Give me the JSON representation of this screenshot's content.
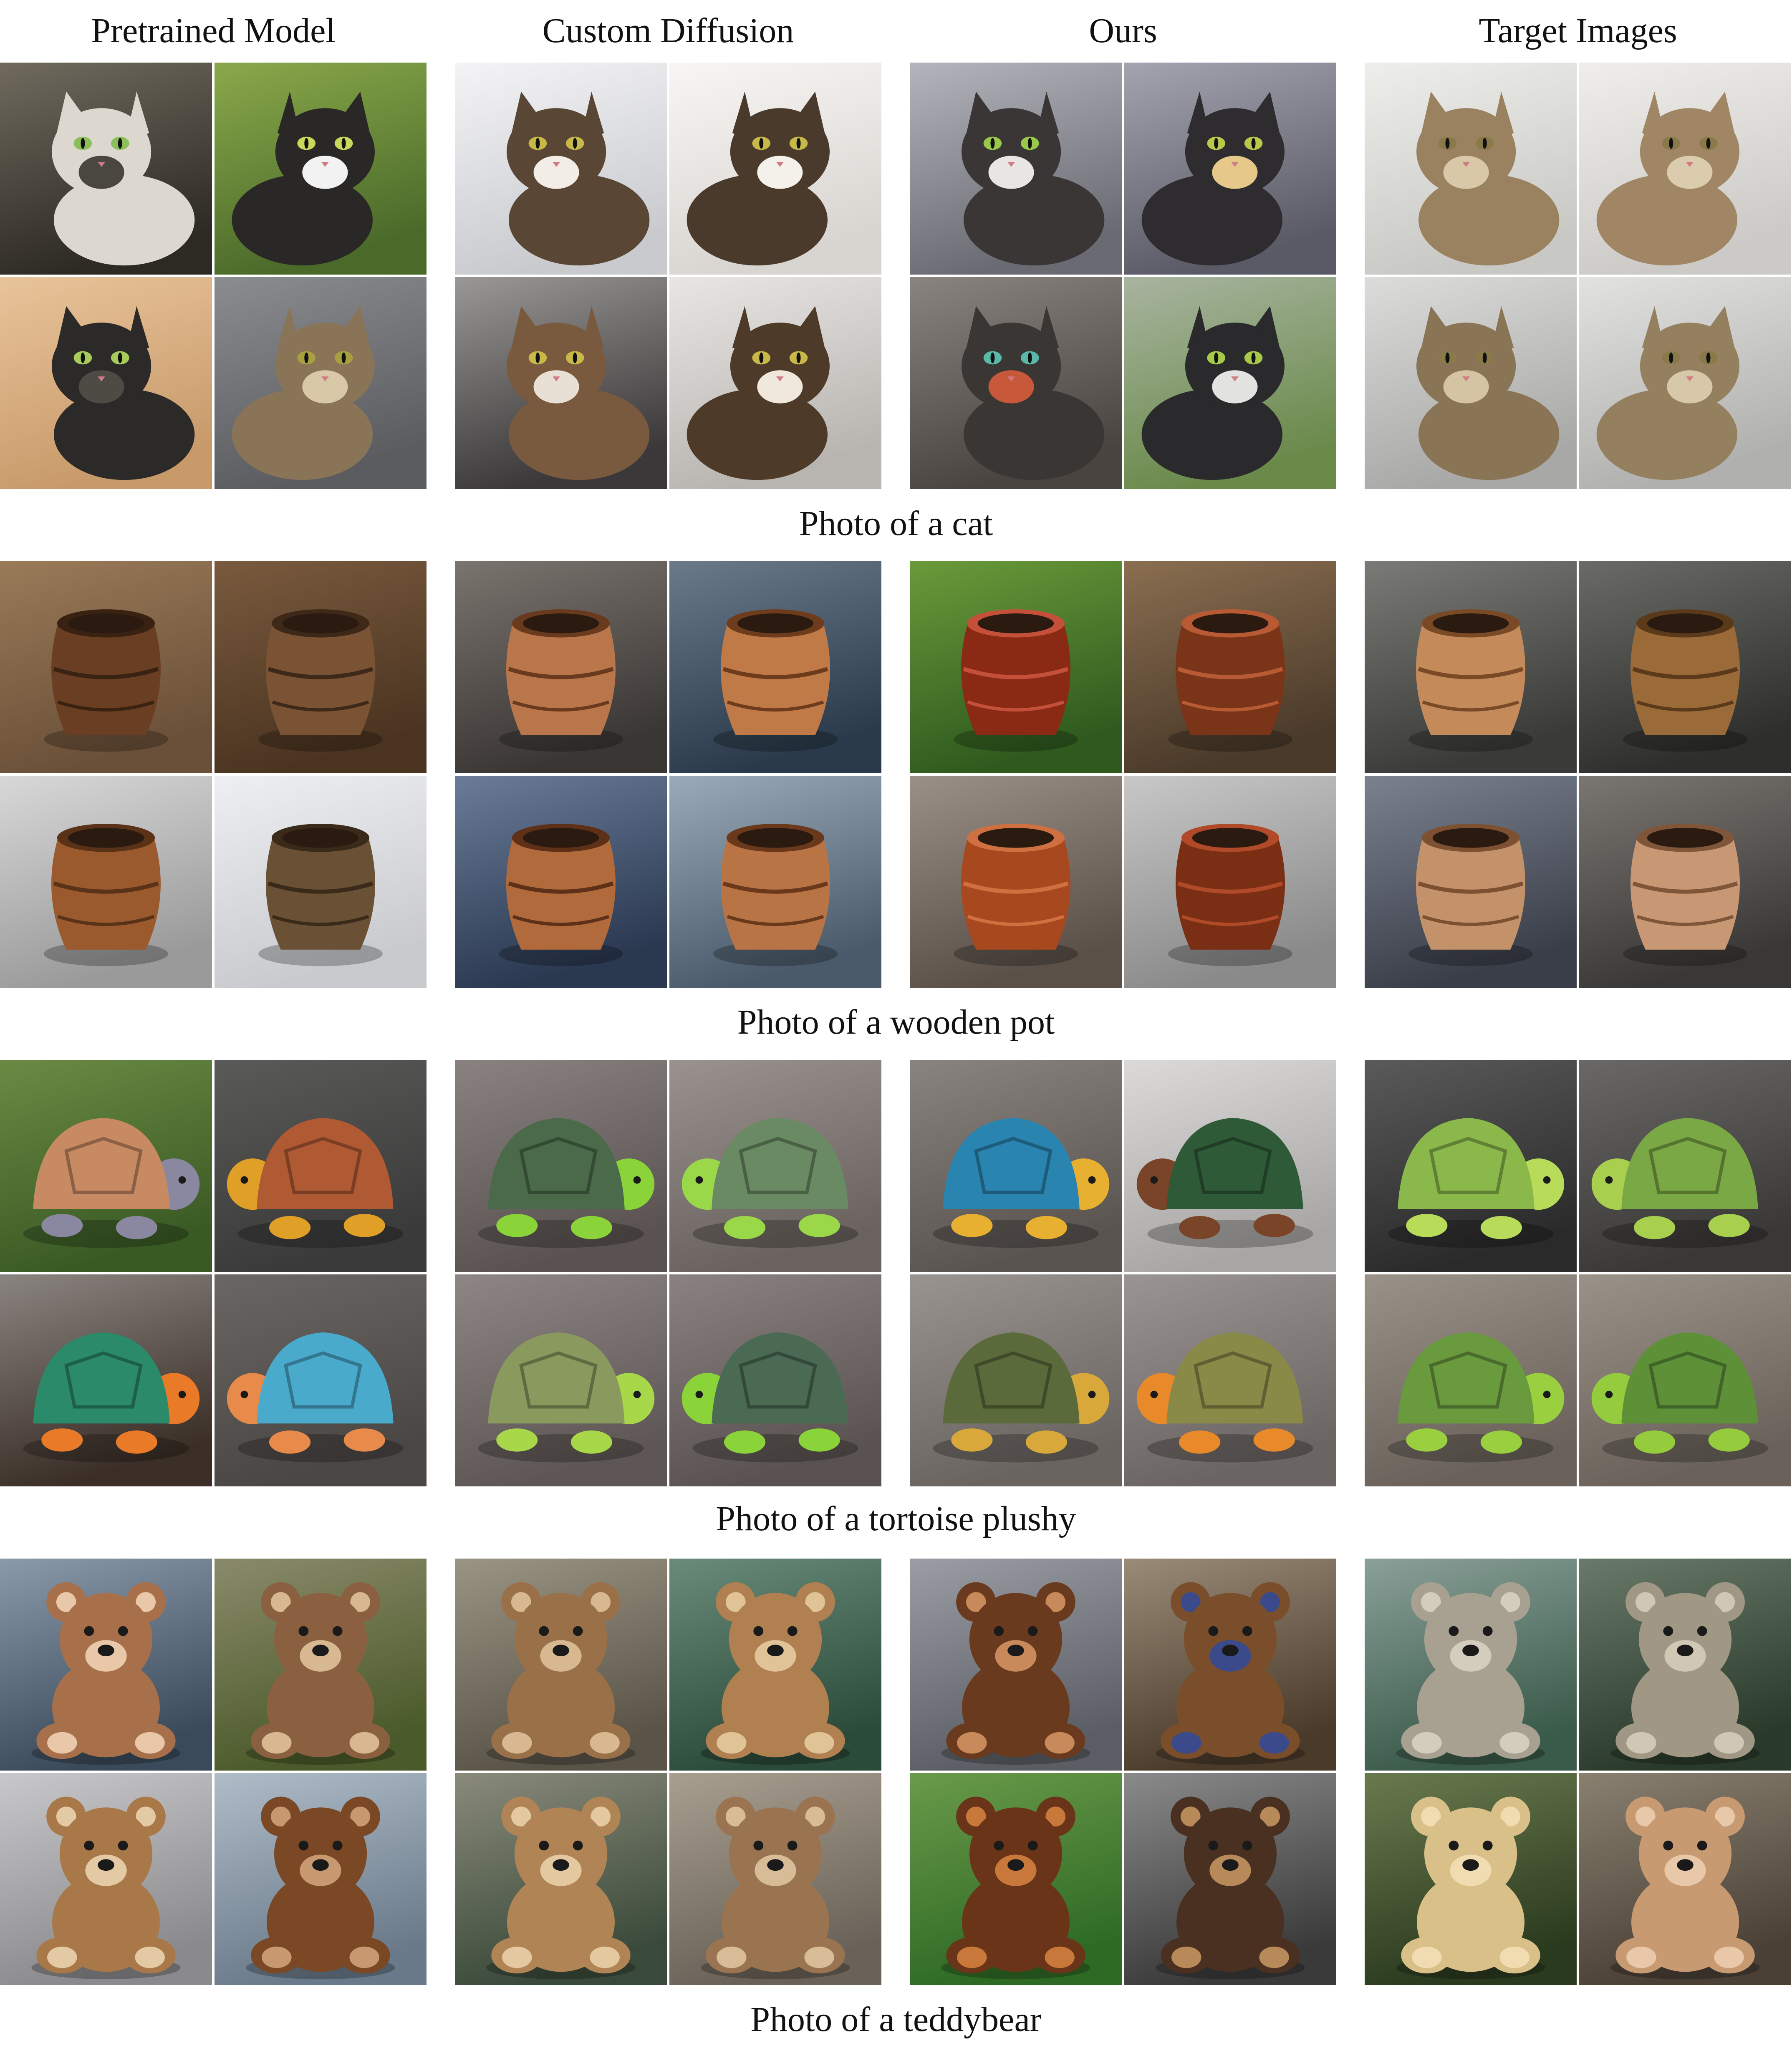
{
  "columns": [
    "Pretrained Model",
    "Custom Diffusion",
    "Ours",
    "Target Images"
  ],
  "rows": [
    {
      "caption": "Photo of a cat",
      "subject": "cat",
      "groups": [
        {
          "tiles": [
            {
              "bg": [
                "#2d2a24",
                "#706a5e"
              ],
              "obj": "#dcd8cf",
              "accent": "#4a4640",
              "eye": "#8bbf5a"
            },
            {
              "bg": [
                "#4a6a2a",
                "#8aa84a"
              ],
              "obj": "#2a2826",
              "accent": "#f2f2f2",
              "eye": "#c8d85a"
            },
            {
              "bg": [
                "#c89a6a",
                "#e8c49a"
              ],
              "obj": "#2c2a28",
              "accent": "#4e4a44",
              "eye": "#a8cc5a"
            },
            {
              "bg": [
                "#5a5c60",
                "#8a8c90"
              ],
              "obj": "#8a7458",
              "accent": "#d8c8a8",
              "eye": "#a8a040"
            }
          ]
        },
        {
          "tiles": [
            {
              "bg": [
                "#c8cace",
                "#f4f4f6"
              ],
              "obj": "#5a4634",
              "accent": "#f2ede6",
              "eye": "#c8b848"
            },
            {
              "bg": [
                "#d8d4d0",
                "#f8f6f4"
              ],
              "obj": "#4a3a2c",
              "accent": "#f4f0ea",
              "eye": "#c8b848"
            },
            {
              "bg": [
                "#3a3838",
                "#9a9896"
              ],
              "obj": "#7a5a3e",
              "accent": "#e8e0d4",
              "eye": "#c8b848"
            },
            {
              "bg": [
                "#b8b4b0",
                "#e8e6e4"
              ],
              "obj": "#4e3a28",
              "accent": "#f0e8dc",
              "eye": "#c8b848"
            }
          ]
        },
        {
          "tiles": [
            {
              "bg": [
                "#6a6a72",
                "#b4b4bc"
              ],
              "obj": "#3a3636",
              "accent": "#e8e6e2",
              "eye": "#9ac84a"
            },
            {
              "bg": [
                "#5a5a66",
                "#a4a4b0"
              ],
              "obj": "#2e2c2e",
              "accent": "#e6c88a",
              "eye": "#b8c848"
            },
            {
              "bg": [
                "#4a4440",
                "#8a8480"
              ],
              "obj": "#3a3634",
              "accent": "#c8583a",
              "eye": "#5ab8a8"
            },
            {
              "bg": [
                "#6a8a4a",
                "#a8b4a0"
              ],
              "obj": "#2a2a2c",
              "accent": "#e2e2e0",
              "eye": "#a8c848"
            }
          ]
        },
        {
          "tiles": [
            {
              "bg": [
                "#c8c8c4",
                "#eeeeea"
              ],
              "obj": "#9a8260",
              "accent": "#d8c8a8",
              "eye": "#8a7a4a"
            },
            {
              "bg": [
                "#cccac6",
                "#f0eeea"
              ],
              "obj": "#a08664",
              "accent": "#dcccae",
              "eye": "#8a7a4a"
            },
            {
              "bg": [
                "#a8a8a6",
                "#dcdcda"
              ],
              "obj": "#8a7456",
              "accent": "#d4c4a4",
              "eye": "#8a7a4a"
            },
            {
              "bg": [
                "#b0b0ae",
                "#e2e2e0"
              ],
              "obj": "#94805e",
              "accent": "#d8c8aa",
              "eye": "#8a7a4a"
            }
          ]
        }
      ]
    },
    {
      "caption": "Photo of a wooden pot",
      "subject": "pot",
      "groups": [
        {
          "tiles": [
            {
              "bg": [
                "#6a5038",
                "#9a7a58"
              ],
              "obj": "#6a3e22",
              "accent": "#3a2212",
              "eye": "#000000"
            },
            {
              "bg": [
                "#4a3420",
                "#7a5a3e"
              ],
              "obj": "#7a5234",
              "accent": "#3e2818",
              "eye": "#000000"
            },
            {
              "bg": [
                "#9a9a9a",
                "#d8d8d8"
              ],
              "obj": "#9a5a2e",
              "accent": "#5a3218",
              "eye": "#000000"
            },
            {
              "bg": [
                "#c8cace",
                "#eeeff2"
              ],
              "obj": "#6a5034",
              "accent": "#3a2a1a",
              "eye": "#000000"
            }
          ]
        },
        {
          "tiles": [
            {
              "bg": [
                "#3a3634",
                "#7a746e"
              ],
              "obj": "#b8764a",
              "accent": "#6a3a1e",
              "eye": "#000000"
            },
            {
              "bg": [
                "#2a3a4a",
                "#6a7a8a"
              ],
              "obj": "#c07a48",
              "accent": "#6e3c1c",
              "eye": "#000000"
            },
            {
              "bg": [
                "#2a3850",
                "#6a7c98"
              ],
              "obj": "#b06a3c",
              "accent": "#5e3018",
              "eye": "#000000"
            },
            {
              "bg": [
                "#4a5a6a",
                "#9aaab8"
              ],
              "obj": "#b87444",
              "accent": "#6a381a",
              "eye": "#000000"
            }
          ]
        },
        {
          "tiles": [
            {
              "bg": [
                "#2e5a1e",
                "#6a9a3a"
              ],
              "obj": "#8a2a14",
              "accent": "#c4503a",
              "eye": "#000000"
            },
            {
              "bg": [
                "#4a3a2a",
                "#8a6e50"
              ],
              "obj": "#7a3418",
              "accent": "#b85a34",
              "eye": "#000000"
            },
            {
              "bg": [
                "#5a5048",
                "#9a9088"
              ],
              "obj": "#a8481e",
              "accent": "#d07040",
              "eye": "#000000"
            },
            {
              "bg": [
                "#8a8a8a",
                "#c8c8c8"
              ],
              "obj": "#7a2e14",
              "accent": "#b04a28",
              "eye": "#000000"
            }
          ]
        },
        {
          "tiles": [
            {
              "bg": [
                "#3a3a38",
                "#7a7a76"
              ],
              "obj": "#c48a5a",
              "accent": "#7a4a26",
              "eye": "#000000"
            },
            {
              "bg": [
                "#2e2e2c",
                "#6a6a66"
              ],
              "obj": "#9a6a38",
              "accent": "#5a3a1a",
              "eye": "#000000"
            },
            {
              "bg": [
                "#3a3e48",
                "#7a8290"
              ],
              "obj": "#c4926a",
              "accent": "#7e5032",
              "eye": "#000000"
            },
            {
              "bg": [
                "#3a3836",
                "#7a7672"
              ],
              "obj": "#c89874",
              "accent": "#80563a",
              "eye": "#000000"
            }
          ]
        }
      ]
    },
    {
      "caption": "Photo of a tortoise plushy",
      "subject": "tortoise",
      "groups": [
        {
          "tiles": [
            {
              "bg": [
                "#3a5a24",
                "#6a8a44"
              ],
              "obj": "#c88a62",
              "accent": "#8a88a0",
              "eye": "#1a1a1a"
            },
            {
              "bg": [
                "#3a3a3a",
                "#5a5a58"
              ],
              "obj": "#b05a34",
              "accent": "#e0a028",
              "eye": "#1a1a1a"
            },
            {
              "bg": [
                "#3a2e26",
                "#8a8480"
              ],
              "obj": "#2a8a6a",
              "accent": "#e87a28",
              "eye": "#1a1a1a"
            },
            {
              "bg": [
                "#4a4644",
                "#6a6664"
              ],
              "obj": "#4aaacc",
              "accent": "#e88a4a",
              "eye": "#1a1a1a"
            }
          ]
        },
        {
          "tiles": [
            {
              "bg": [
                "#5a5250",
                "#8a8280"
              ],
              "obj": "#4a6a4a",
              "accent": "#8ad43a",
              "eye": "#1a1a1a"
            },
            {
              "bg": [
                "#6a625e",
                "#9a928e"
              ],
              "obj": "#6a8a64",
              "accent": "#9ad84a",
              "eye": "#1a1a1a"
            },
            {
              "bg": [
                "#5e5654",
                "#8e8684"
              ],
              "obj": "#8a9a5e",
              "accent": "#a8d84a",
              "eye": "#1a1a1a"
            },
            {
              "bg": [
                "#5a5250",
                "#8a8280"
              ],
              "obj": "#4a6a54",
              "accent": "#8ad43a",
              "eye": "#1a1a1a"
            }
          ]
        },
        {
          "tiles": [
            {
              "bg": [
                "#5a5450",
                "#8a8480"
              ],
              "obj": "#2a84b0",
              "accent": "#e8b030",
              "eye": "#1a1a1a"
            },
            {
              "bg": [
                "#a8a6a4",
                "#dcdad8"
              ],
              "obj": "#2e5a38",
              "accent": "#7a4428",
              "eye": "#1a1a1a"
            },
            {
              "bg": [
                "#6a6460",
                "#9a9490"
              ],
              "obj": "#5a6a3a",
              "accent": "#d8a83a",
              "eye": "#1a1a1a"
            },
            {
              "bg": [
                "#6a6462",
                "#9a9492"
              ],
              "obj": "#8a8a48",
              "accent": "#e88a2a",
              "eye": "#1a1a1a"
            }
          ]
        },
        {
          "tiles": [
            {
              "bg": [
                "#2a2a2a",
                "#5a5a5a"
              ],
              "obj": "#8ab84a",
              "accent": "#b8dc5a",
              "eye": "#1a1a1a"
            },
            {
              "bg": [
                "#3a3836",
                "#6a6866"
              ],
              "obj": "#7aa844",
              "accent": "#a8d04e",
              "eye": "#1a1a1a"
            },
            {
              "bg": [
                "#6a625a",
                "#9a9288"
              ],
              "obj": "#6a9a3e",
              "accent": "#9ad040",
              "eye": "#1a1a1a"
            },
            {
              "bg": [
                "#6a625a",
                "#9a9288"
              ],
              "obj": "#5e9038",
              "accent": "#94cc3e",
              "eye": "#1a1a1a"
            }
          ]
        }
      ]
    },
    {
      "caption": "Photo of a teddybear",
      "subject": "bear",
      "groups": [
        {
          "tiles": [
            {
              "bg": [
                "#3a4a5a",
                "#8a9aaa"
              ],
              "obj": "#a8704a",
              "accent": "#e8c8a8",
              "eye": "#1a1a1a"
            },
            {
              "bg": [
                "#4a5a2a",
                "#8a8a6a"
              ],
              "obj": "#8a6040",
              "accent": "#d8b890",
              "eye": "#1a1a1a"
            },
            {
              "bg": [
                "#8a8a8c",
                "#c8c8ca"
              ],
              "obj": "#a87848",
              "accent": "#e4caa4",
              "eye": "#1a1a1a"
            },
            {
              "bg": [
                "#6a7a8a",
                "#b0bcc8"
              ],
              "obj": "#7a4824",
              "accent": "#c89870",
              "eye": "#1a1a1a"
            }
          ]
        },
        {
          "tiles": [
            {
              "bg": [
                "#5a5448",
                "#9a9484"
              ],
              "obj": "#9a7048",
              "accent": "#d8b890",
              "eye": "#1a1a1a"
            },
            {
              "bg": [
                "#2a4a3a",
                "#6a8a7a"
              ],
              "obj": "#b08050",
              "accent": "#e0c498",
              "eye": "#1a1a1a"
            },
            {
              "bg": [
                "#3a4a3a",
                "#8a8a7a"
              ],
              "obj": "#b08454",
              "accent": "#e4c8a0",
              "eye": "#1a1a1a"
            },
            {
              "bg": [
                "#6a6258",
                "#a89e90"
              ],
              "obj": "#9a7450",
              "accent": "#d8bc98",
              "eye": "#1a1a1a"
            }
          ]
        },
        {
          "tiles": [
            {
              "bg": [
                "#5a5e64",
                "#9a9ea4"
              ],
              "obj": "#6a3a1e",
              "accent": "#c88a5a",
              "eye": "#1a1a1a"
            },
            {
              "bg": [
                "#4a3a2a",
                "#9a8a78"
              ],
              "obj": "#7a4e2a",
              "accent": "#3a4a8a",
              "eye": "#1a1a1a"
            },
            {
              "bg": [
                "#2e6a24",
                "#6a9a4a"
              ],
              "obj": "#6a3418",
              "accent": "#c8783a",
              "eye": "#1a1a1a"
            },
            {
              "bg": [
                "#3a3a3a",
                "#8a8a8a"
              ],
              "obj": "#4a3020",
              "accent": "#b88a5a",
              "eye": "#1a1a1a"
            }
          ]
        },
        {
          "tiles": [
            {
              "bg": [
                "#3a5a4a",
                "#8aa098"
              ],
              "obj": "#a8a090",
              "accent": "#d4ccbc",
              "eye": "#1a1a1a"
            },
            {
              "bg": [
                "#2a3a2a",
                "#6a7a6a"
              ],
              "obj": "#a09884",
              "accent": "#d0c8b4",
              "eye": "#1a1a1a"
            },
            {
              "bg": [
                "#2a3a1e",
                "#6a7a4e"
              ],
              "obj": "#d8c088",
              "accent": "#f0dcb0",
              "eye": "#1a1a1a"
            },
            {
              "bg": [
                "#4a4036",
                "#8a8070"
              ],
              "obj": "#c89a72",
              "accent": "#e8c8a8",
              "eye": "#1a1a1a"
            }
          ]
        }
      ]
    }
  ]
}
